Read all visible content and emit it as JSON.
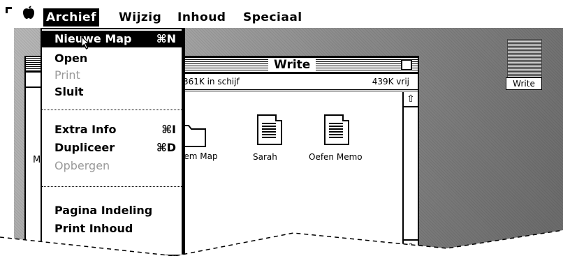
{
  "menubar": {
    "apple": "",
    "menus": [
      "Archief",
      "Wijzig",
      "Inhoud",
      "Speciaal"
    ],
    "active_menu": "Archief"
  },
  "archief_menu": {
    "items": [
      {
        "label": "Nieuwe Map",
        "shortcut": "⌘N",
        "state": "highlighted"
      },
      {
        "label": "Open",
        "shortcut": "",
        "state": "enabled"
      },
      {
        "label": "Print",
        "shortcut": "",
        "state": "disabled"
      },
      {
        "label": "Sluit",
        "shortcut": "",
        "state": "enabled"
      },
      {
        "label": "Extra Info",
        "shortcut": "⌘I",
        "state": "enabled"
      },
      {
        "label": "Dupliceer",
        "shortcut": "⌘D",
        "state": "enabled"
      },
      {
        "label": "Opbergen",
        "shortcut": "",
        "state": "disabled"
      },
      {
        "label": "Pagina Indeling",
        "shortcut": "",
        "state": "enabled"
      },
      {
        "label": "Print Inhoud",
        "shortcut": "",
        "state": "enabled"
      }
    ]
  },
  "desktop": {
    "disk_icon_label": "Write"
  },
  "write_window": {
    "title": "Write",
    "info_left": "361K in schijf",
    "info_right": "439K vrij",
    "files": [
      {
        "name": "eem Map",
        "icon": "folder-icon"
      },
      {
        "name": "Sarah",
        "icon": "document-icon"
      },
      {
        "name": "Oefen Memo",
        "icon": "document-icon"
      }
    ]
  },
  "back_window": {
    "partial_text": "M"
  },
  "colors": {
    "highlight": "#000000",
    "disabled_text": "#9a9a9a",
    "desktop": "#8a8a8a"
  }
}
